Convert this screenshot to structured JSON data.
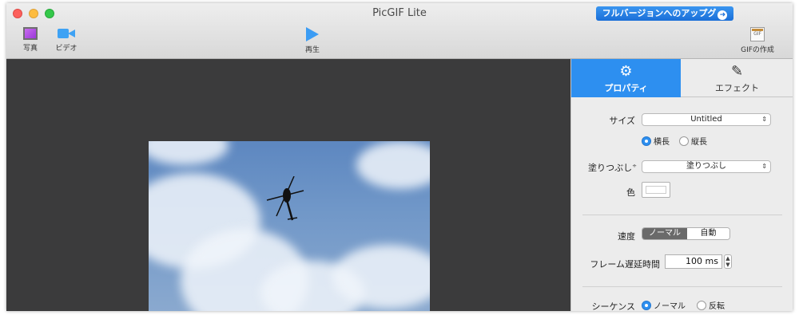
{
  "window": {
    "title": "PicGIF Lite",
    "upgrade_label": "フルバージョンへのアップグ",
    "upgrade_arrow": "➜"
  },
  "toolbar": {
    "photo_label": "写真",
    "video_label": "ビデオ",
    "play_label": "再生",
    "make_gif_label": "GIFの作成",
    "gif_icon_text": "GIF"
  },
  "tabs": {
    "properties": {
      "label": "プロパティ",
      "icon": "gear-icon",
      "glyph": "⚙"
    },
    "effect": {
      "label": "エフェクト",
      "icon": "magic-wand-icon",
      "glyph": "✎"
    }
  },
  "properties": {
    "size_label": "サイズ",
    "size_value": "Untitled",
    "orientation_options": [
      "横長",
      "縦長"
    ],
    "orientation_selected": "横長",
    "fill_label": "塗りつぶし",
    "fill_value": "塗りつぶし",
    "color_label": "色",
    "color_value": "#ffffff",
    "speed_label": "速度",
    "speed_options": [
      "ノーマル",
      "自動"
    ],
    "speed_selected": "ノーマル",
    "frame_delay_label": "フレーム遅延時間",
    "frame_delay_value": "100 ms",
    "sequence_label": "シーケンス",
    "sequence_options": [
      "ノーマル",
      "反転"
    ],
    "sequence_selected": "ノーマル"
  },
  "colors": {
    "accent": "#2d8ff0",
    "stage_bg": "#3b3b3c"
  }
}
